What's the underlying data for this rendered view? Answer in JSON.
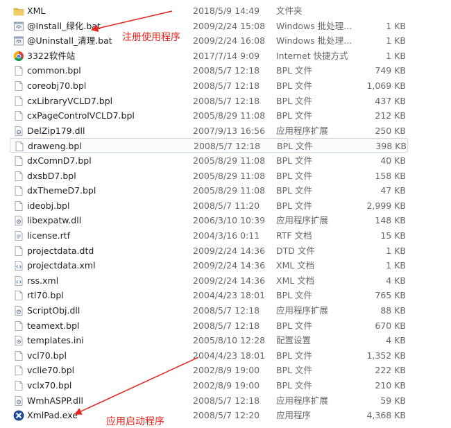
{
  "files": [
    {
      "name": "XML",
      "date": "2018/5/9 14:49",
      "type": "文件夹",
      "size": "",
      "icon": "folder-icon"
    },
    {
      "name": "@Install_绿化.bat",
      "date": "2009/2/24 15:08",
      "type": "Windows 批处理...",
      "size": "1 KB",
      "icon": "batch-file-icon"
    },
    {
      "name": "@Uninstall_清理.bat",
      "date": "2009/2/24 16:08",
      "type": "Windows 批处理...",
      "size": "1 KB",
      "icon": "batch-file-icon"
    },
    {
      "name": "3322软件站",
      "date": "2017/7/14 9:09",
      "type": "Internet 快捷方式",
      "size": "1 KB",
      "icon": "chrome-shortcut-icon"
    },
    {
      "name": "common.bpl",
      "date": "2008/5/7 12:18",
      "type": "BPL 文件",
      "size": "749 KB",
      "icon": "file-icon"
    },
    {
      "name": "coreobj70.bpl",
      "date": "2008/5/7 12:18",
      "type": "BPL 文件",
      "size": "1,069 KB",
      "icon": "file-icon"
    },
    {
      "name": "cxLibraryVCLD7.bpl",
      "date": "2008/5/7 12:18",
      "type": "BPL 文件",
      "size": "437 KB",
      "icon": "file-icon"
    },
    {
      "name": "cxPageControlVCLD7.bpl",
      "date": "2005/8/29 11:08",
      "type": "BPL 文件",
      "size": "212 KB",
      "icon": "file-icon"
    },
    {
      "name": "DelZip179.dll",
      "date": "2007/9/13 16:56",
      "type": "应用程序扩展",
      "size": "250 KB",
      "icon": "dll-file-icon"
    },
    {
      "name": "draweng.bpl",
      "date": "2008/5/7 12:18",
      "type": "BPL 文件",
      "size": "398 KB",
      "icon": "file-icon"
    },
    {
      "name": "dxComnD7.bpl",
      "date": "2005/8/29 11:08",
      "type": "BPL 文件",
      "size": "40 KB",
      "icon": "file-icon"
    },
    {
      "name": "dxsbD7.bpl",
      "date": "2005/8/29 11:08",
      "type": "BPL 文件",
      "size": "158 KB",
      "icon": "file-icon"
    },
    {
      "name": "dxThemeD7.bpl",
      "date": "2005/8/29 11:08",
      "type": "BPL 文件",
      "size": "47 KB",
      "icon": "file-icon"
    },
    {
      "name": "ideobj.bpl",
      "date": "2008/5/7 11:20",
      "type": "BPL 文件",
      "size": "2,999 KB",
      "icon": "file-icon"
    },
    {
      "name": "libexpatw.dll",
      "date": "2006/3/10 10:39",
      "type": "应用程序扩展",
      "size": "148 KB",
      "icon": "dll-file-icon"
    },
    {
      "name": "license.rtf",
      "date": "2004/3/16 0:11",
      "type": "RTF 文档",
      "size": "15 KB",
      "icon": "rtf-file-icon"
    },
    {
      "name": "projectdata.dtd",
      "date": "2009/2/24 14:36",
      "type": "DTD 文件",
      "size": "1 KB",
      "icon": "file-icon"
    },
    {
      "name": "projectdata.xml",
      "date": "2009/2/24 14:36",
      "type": "XML 文档",
      "size": "1 KB",
      "icon": "xml-file-icon"
    },
    {
      "name": "rss.xml",
      "date": "2009/2/24 14:36",
      "type": "XML 文档",
      "size": "4 KB",
      "icon": "xml-file-icon"
    },
    {
      "name": "rtl70.bpl",
      "date": "2004/4/23 18:01",
      "type": "BPL 文件",
      "size": "765 KB",
      "icon": "file-icon"
    },
    {
      "name": "ScriptObj.dll",
      "date": "2008/5/7 12:18",
      "type": "应用程序扩展",
      "size": "88 KB",
      "icon": "dll-file-icon"
    },
    {
      "name": "teamext.bpl",
      "date": "2008/5/7 12:18",
      "type": "BPL 文件",
      "size": "670 KB",
      "icon": "file-icon"
    },
    {
      "name": "templates.ini",
      "date": "2005/8/10 12:28",
      "type": "配置设置",
      "size": "4 KB",
      "icon": "ini-file-icon"
    },
    {
      "name": "vcl70.bpl",
      "date": "2004/4/23 18:01",
      "type": "BPL 文件",
      "size": "1,352 KB",
      "icon": "file-icon"
    },
    {
      "name": "vclie70.bpl",
      "date": "2002/8/9 19:00",
      "type": "BPL 文件",
      "size": "222 KB",
      "icon": "file-icon"
    },
    {
      "name": "vclx70.bpl",
      "date": "2002/8/9 19:00",
      "type": "BPL 文件",
      "size": "210 KB",
      "icon": "file-icon"
    },
    {
      "name": "WmhASPP.dll",
      "date": "2008/5/7 12:18",
      "type": "应用程序扩展",
      "size": "59 KB",
      "icon": "dll-file-icon"
    },
    {
      "name": "XmlPad.exe",
      "date": "2008/5/7 12:20",
      "type": "应用程序",
      "size": "4,368 KB",
      "icon": "xmlpad-app-icon"
    }
  ],
  "selected_file": "draweng.bpl",
  "annotations": {
    "register": "注册使用程序",
    "launch": "应用启动程序"
  },
  "colors": {
    "annotation": "#e8231d",
    "selection_border": "#d3d9e2",
    "folder": "#e8b84a"
  }
}
